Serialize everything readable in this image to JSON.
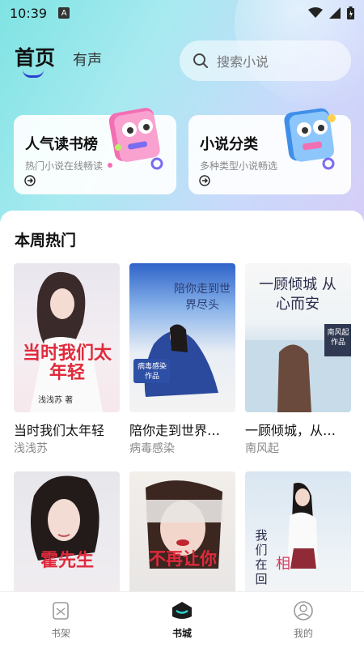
{
  "status_bar": {
    "time": "10:39",
    "notification": "A"
  },
  "header": {
    "tab_home": "首页",
    "tab_audio": "有声",
    "search_placeholder": "搜索小说"
  },
  "features": [
    {
      "title": "人气读书榜",
      "subtitle": "热门小说在线畅读"
    },
    {
      "title": "小说分类",
      "subtitle": "多种类型小说畅选"
    }
  ],
  "section": {
    "title": "本周热门"
  },
  "books_row1": [
    {
      "title": "当时我们太年轻",
      "author": "浅浅苏",
      "cover_text": "当时我们太年轻",
      "cover_author": "浅浅苏 著"
    },
    {
      "title": "陪你走到世界…",
      "author": "病毒感染",
      "cover_text": "陪你走到世界尽头",
      "cover_author": "病毒感染 作品"
    },
    {
      "title": "一顾倾城，从…",
      "author": "南风起",
      "cover_text": "一顾倾城 从心而安",
      "cover_author": "南风起 作品"
    }
  ],
  "books_row2": [
    {
      "cover_text": "霍先生"
    },
    {
      "cover_text": "不再让你"
    },
    {
      "cover_text": "我们在回",
      "cover_text2": "相"
    }
  ],
  "bottom_nav": [
    {
      "label": "书架",
      "icon": "bookshelf-icon"
    },
    {
      "label": "书城",
      "icon": "bookstore-icon"
    },
    {
      "label": "我的",
      "icon": "profile-icon"
    }
  ],
  "colors": {
    "accent": "#2a3fd0",
    "hero_start": "#7fe3e3",
    "hero_end": "#d7cdf7"
  }
}
